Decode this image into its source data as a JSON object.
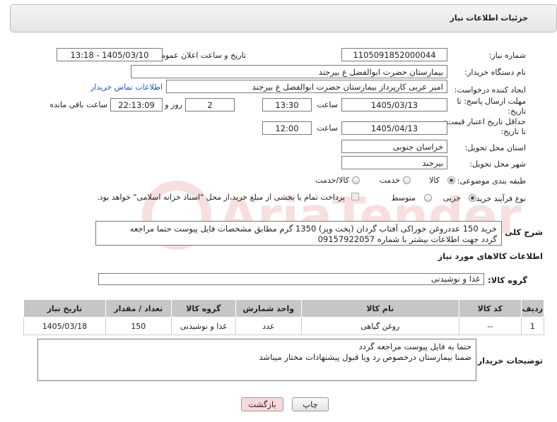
{
  "header": {
    "title": "جزئیات اطلاعات نیاز"
  },
  "form": {
    "need_number_label": "شماره نیاز:",
    "need_number": "1105091852000044",
    "announce_label": "تاریخ و ساعت اعلان عمومی:",
    "announce_value": "1405/03/10 - 13:18",
    "buyer_org_label": "نام دستگاه خریدار:",
    "buyer_org": "بیمارستان حضرت ابوالفضل  ع  بیرجند",
    "creator_label": "ایجاد کننده درخواست:",
    "creator": "امیر عربی کارپرداز بیمارستان حضرت ابوالفضل  ع  بیرجند",
    "contact_link": "اطلاعات تماس خریدار",
    "deadline_label_1": "مهلت ارسال پاسخ: تا",
    "deadline_label_2": "تاریخ:",
    "deadline_date": "1405/03/13",
    "time_label": "ساعت",
    "deadline_time": "13:30",
    "days_value": "2",
    "days_label": "روز و",
    "remaining_time": "22:13:09",
    "remaining_label": "ساعت باقی مانده",
    "validity_label_1": "حداقل تاریخ اعتبار قیمت:",
    "validity_label_2": "تا تاریخ:",
    "validity_date": "1405/04/13",
    "validity_time_label": "ساعت",
    "validity_time": "12:00",
    "province_label": "استان محل تحویل:",
    "province": "خراسان جنوبی",
    "city_label": "شهر محل تحویل:",
    "city": "بیرجند",
    "category_label": "طبقه بندی موضوعی:",
    "category_options": [
      "کالا",
      "خدمت",
      "کالا/خدمت"
    ],
    "purchase_type_label": "نوع فرآیند خرید :",
    "purchase_options": [
      "جزیی",
      "متوسط"
    ],
    "payment_note": "پرداخت تمام یا بخشی از مبلغ خرید،از محل \"اسناد خزانه اسلامی\" خواهد بود."
  },
  "general_desc": {
    "label": "شرح کلی نیاز:",
    "line1": "خرید 150 عددروغن خوراکی آفتاب گردان (پخت وپز) 1350 گرم مطابق مشخصات فایل پیوست حتما مراجعه",
    "line2": "گردد جهت اطلاعات بیشتر با شماره 09157922057"
  },
  "goods": {
    "section_title": "اطلاعات کالاهای مورد نیاز",
    "group_label": "گروه کالا:",
    "group_value": "غذا و نوشیدنی",
    "columns": [
      "ردیف",
      "کد کالا",
      "نام کالا",
      "واحد شمارش",
      "گروه کالا",
      "تعداد / مقدار",
      "تاریخ نیاز"
    ],
    "rows": [
      [
        "1",
        "--",
        "روغن گیاهی",
        "عدد",
        "غذا و نوشیدنی",
        "150",
        "1405/03/18"
      ]
    ]
  },
  "buyer_notes": {
    "label": "توضیحات خریدار:",
    "line1": "حتما به فایل پیوست مراجعه گردد",
    "line2": "ضمنا بیمارستان درخصوص رد ویا قبول پیشنهادات مختار میباشد"
  },
  "buttons": {
    "print": "چاپ",
    "back": "بازگشت"
  },
  "colors": {
    "link": "#1a56c8",
    "back_button_bg": "#f9d9dc",
    "table_header": "#c6c6c6"
  }
}
